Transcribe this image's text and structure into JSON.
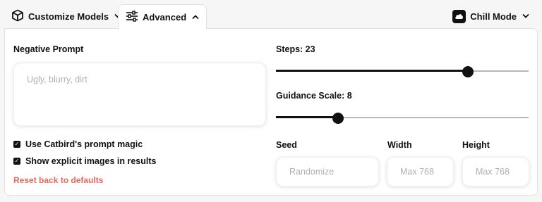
{
  "tabs": {
    "customize": {
      "label": "Customize Models",
      "icon": "cube-icon",
      "chevron": "˅"
    },
    "advanced": {
      "label": "Advanced",
      "icon": "sliders-icon",
      "chevron": "^"
    },
    "mode": {
      "label": "Chill Mode",
      "icon": "cloud-icon",
      "chevron": "˅"
    }
  },
  "negative_prompt": {
    "label": "Negative Prompt",
    "placeholder": "Ugly, blurry, dirt"
  },
  "options": {
    "prompt_magic": {
      "label": "Use Catbird's prompt magic",
      "checked": true
    },
    "explicit": {
      "label": "Show explicit images in results",
      "checked": true
    }
  },
  "reset_label": "Reset back to defaults",
  "steps": {
    "label": "Steps: 23",
    "value": 23,
    "level": 0.76
  },
  "guidance": {
    "label": "Guidance Scale: 8",
    "value": 8,
    "level": 0.245
  },
  "seed": {
    "label": "Seed",
    "placeholder": "Randomize"
  },
  "width": {
    "label": "Width",
    "placeholder": "Max 768"
  },
  "height": {
    "label": "Height",
    "placeholder": "Max 768"
  },
  "colors": {
    "accent": "#111111",
    "reset": "#e4695f",
    "placeholder": "#b0b0b0",
    "track": "#b8b8b8"
  }
}
